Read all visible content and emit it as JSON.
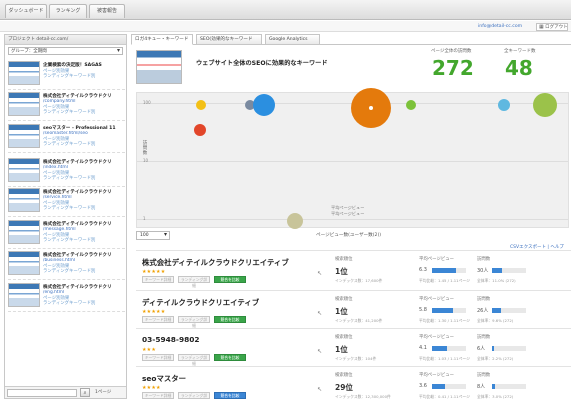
{
  "nav": {
    "tabs": [
      "ダッシュボード",
      "ランキング",
      "被害報告"
    ]
  },
  "user": {
    "email": "info@detail-cc.com",
    "logout": "ログアウト",
    "logout_icon": "grid-icon"
  },
  "sidebar": {
    "header": "プロジェクト  detail-cc.com/",
    "filter": "グループ：全期間",
    "search_placeholder": "",
    "page_label": "1ページ",
    "sites": [
      {
        "title": "企業検索の決定版！SAGAS",
        "url": "",
        "link1": "ページ別効果",
        "link2": "ランディングキーワード別"
      },
      {
        "title": "株式会社ディテイルクラウドクリ",
        "url": "/company.html",
        "link1": "ページ別効果",
        "link2": "ランディングキーワード別"
      },
      {
        "title": "seoマスター - Professional 11",
        "url": "/seomaster.html/seo",
        "link1": "ページ別効果",
        "link2": "ランディングキーワード別"
      },
      {
        "title": "株式会社ディテイルクラウドクリ",
        "url": "/index.html",
        "link1": "ページ別効果",
        "link2": "ランディングキーワード別"
      },
      {
        "title": "株式会社ディテイルクラウドクリ",
        "url": "/service.html",
        "link1": "ページ別効果",
        "link2": "ランディングキーワード別"
      },
      {
        "title": "株式会社ディテイルクラウドクリ",
        "url": "/message.html",
        "link1": "ページ別効果",
        "link2": "ランディングキーワード別"
      },
      {
        "title": "株式会社ディテイルクラウドクリ",
        "url": "/business.html",
        "link1": "ページ別効果",
        "link2": "ランディングキーワード別"
      },
      {
        "title": "株式会社ディテイルクラウドクリ",
        "url": "/eng.html",
        "link1": "ページ別効果",
        "link2": "ランディングキーワード別"
      }
    ]
  },
  "tabs": [
    "ロガ4キュー・キーワード",
    "SEO(効果的なキーワード",
    "Google Analytics"
  ],
  "hero": {
    "title": "ウェブサイト全体のSEOに効果的なキーワード",
    "stat1_label": "ページ全体の訪問数",
    "stat1_value": "272",
    "stat2_label": "全キーワード数",
    "stat2_value": "48"
  },
  "chart": {
    "ylabel": "訪問数",
    "yticks": [
      "100",
      "10",
      "1"
    ],
    "xnote1": "平均ページビュー",
    "xnote2": "平均ページビュー",
    "xlabel": "ページビュー数(ユーザー数(2))",
    "zoom": "100",
    "bubbles": [
      {
        "color": "#f3c016",
        "dot": false
      },
      {
        "color": "#7a8aa0",
        "dot": false
      },
      {
        "color": "#2b8fe0",
        "dot": false
      },
      {
        "color": "#e47a0c",
        "dot": true
      },
      {
        "color": "#7cc23a",
        "dot": false
      },
      {
        "color": "#5fb8e0",
        "dot": false
      },
      {
        "color": "#9bc24a",
        "dot": false
      },
      {
        "color": "#e2462a",
        "dot": false
      },
      {
        "color": "#c8c49a",
        "dot": false
      }
    ]
  },
  "csv": "CSVエクスポート  |  ヘルプ",
  "rows": [
    {
      "title": "株式会社ディテイルクラウドクリエイティブ",
      "stars": "★★★★★",
      "btn1": "キーワード詳細",
      "btn2": "ランディング詳細",
      "btn3": "競合を比較",
      "btn3_color": "g",
      "rank_h": "検索順位",
      "rank": "1位",
      "rank_s": "インデックス数：17,600件",
      "pv_h": "平均ページビュー",
      "pv_v": "6.3",
      "pv_s": "平均比較：1.45 / 1.11ページ",
      "pv_fill": 0.7,
      "visit_h": "訪問数",
      "visit_v": "30人",
      "visit_s": "全体率：11.0% (272)",
      "visit_fill": 0.3
    },
    {
      "title": "ディテイルクラウドクリエイティブ",
      "stars": "★★★★★",
      "btn1": "キーワード詳細",
      "btn2": "ランディング詳細",
      "btn3": "競合を比較",
      "btn3_color": "g",
      "rank_h": "検索順位",
      "rank": "1位",
      "rank_s": "インデックス数：41,200件",
      "pv_h": "平均ページビュー",
      "pv_v": "5.8",
      "pv_s": "平均比較：1.30 / 1.11ページ",
      "pv_fill": 0.62,
      "visit_h": "訪問数",
      "visit_v": "26人",
      "visit_s": "全体率：9.6% (272)",
      "visit_fill": 0.26
    },
    {
      "title": "03-5948-9802",
      "stars": "★★★",
      "btn1": "キーワード詳細",
      "btn2": "ランディング詳細",
      "btn3": "競合を比較",
      "btn3_color": "g",
      "rank_h": "検索順位",
      "rank": "1位",
      "rank_s": "インデックス数：104件",
      "pv_h": "平均ページビュー",
      "pv_v": "4.1",
      "pv_s": "平均比較：1.03 / 1.11ページ",
      "pv_fill": 0.45,
      "visit_h": "訪問数",
      "visit_v": "6人",
      "visit_s": "全体率：2.2% (272)",
      "visit_fill": 0.06
    },
    {
      "title": "seoマスター",
      "stars": "★★★★",
      "btn1": "キーワード詳細",
      "btn2": "ランディング詳細",
      "btn3": "競合を比較",
      "btn3_color": "b",
      "rank_h": "検索順位",
      "rank": "29位",
      "rank_s": "インデックス数：12,300,000件",
      "pv_h": "平均ページビュー",
      "pv_v": "3.6",
      "pv_s": "平均比較：0.41 / 1.11ページ",
      "pv_fill": 0.38,
      "visit_h": "訪問数",
      "visit_v": "8人",
      "visit_s": "全体率：3.0% (272)",
      "visit_fill": 0.08
    }
  ]
}
